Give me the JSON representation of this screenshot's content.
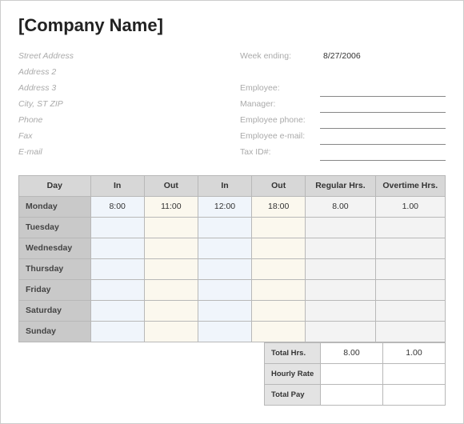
{
  "company_name": "[Company Name]",
  "address": {
    "street": "Street Address",
    "addr2": "Address 2",
    "addr3": "Address 3",
    "city": "City, ST  ZIP",
    "phone": "Phone",
    "fax": "Fax",
    "email": "E-mail"
  },
  "meta": {
    "week_ending_label": "Week ending:",
    "week_ending": "8/27/2006",
    "employee_label": "Employee:",
    "employee": "",
    "manager_label": "Manager:",
    "manager": "",
    "emp_phone_label": "Employee phone:",
    "emp_phone": "",
    "emp_email_label": "Employee e-mail:",
    "emp_email": "",
    "tax_label": "Tax ID#:",
    "tax": ""
  },
  "headers": {
    "day": "Day",
    "in": "In",
    "out": "Out",
    "reg": "Regular Hrs.",
    "ot": "Overtime Hrs."
  },
  "rows": [
    {
      "day": "Monday",
      "in1": "8:00",
      "out1": "11:00",
      "in2": "12:00",
      "out2": "18:00",
      "reg": "8.00",
      "ot": "1.00"
    },
    {
      "day": "Tuesday",
      "in1": "",
      "out1": "",
      "in2": "",
      "out2": "",
      "reg": "",
      "ot": ""
    },
    {
      "day": "Wednesday",
      "in1": "",
      "out1": "",
      "in2": "",
      "out2": "",
      "reg": "",
      "ot": ""
    },
    {
      "day": "Thursday",
      "in1": "",
      "out1": "",
      "in2": "",
      "out2": "",
      "reg": "",
      "ot": ""
    },
    {
      "day": "Friday",
      "in1": "",
      "out1": "",
      "in2": "",
      "out2": "",
      "reg": "",
      "ot": ""
    },
    {
      "day": "Saturday",
      "in1": "",
      "out1": "",
      "in2": "",
      "out2": "",
      "reg": "",
      "ot": ""
    },
    {
      "day": "Sunday",
      "in1": "",
      "out1": "",
      "in2": "",
      "out2": "",
      "reg": "",
      "ot": ""
    }
  ],
  "totals": {
    "total_hrs_label": "Total Hrs.",
    "total_reg": "8.00",
    "total_ot": "1.00",
    "hourly_rate_label": "Hourly Rate",
    "hourly_reg": "",
    "hourly_ot": "",
    "total_pay_label": "Total Pay",
    "pay_reg": "",
    "pay_ot": ""
  }
}
